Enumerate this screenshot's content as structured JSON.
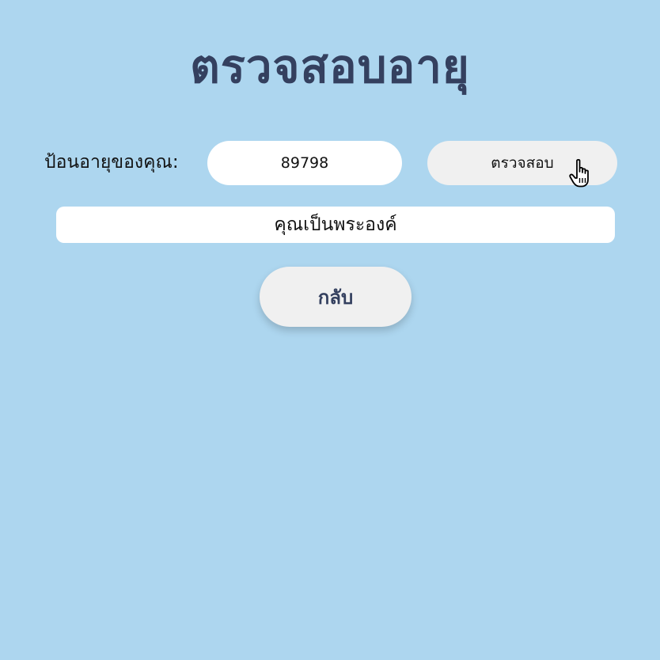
{
  "page": {
    "title": "ตรวจสอบอายุ"
  },
  "form": {
    "age_label": "ป้อนอายุของคุณ:",
    "age_value": "89798",
    "check_button_label": "ตรวจสอบ"
  },
  "result": {
    "text": "คุณเป็นพระองค์"
  },
  "back_button_label": "กลับ",
  "colors": {
    "background": "#add6ef",
    "title": "#34405f",
    "button_bg": "#f0f0f0"
  },
  "icons": {
    "cursor": "hand-pointer-cursor-icon"
  }
}
